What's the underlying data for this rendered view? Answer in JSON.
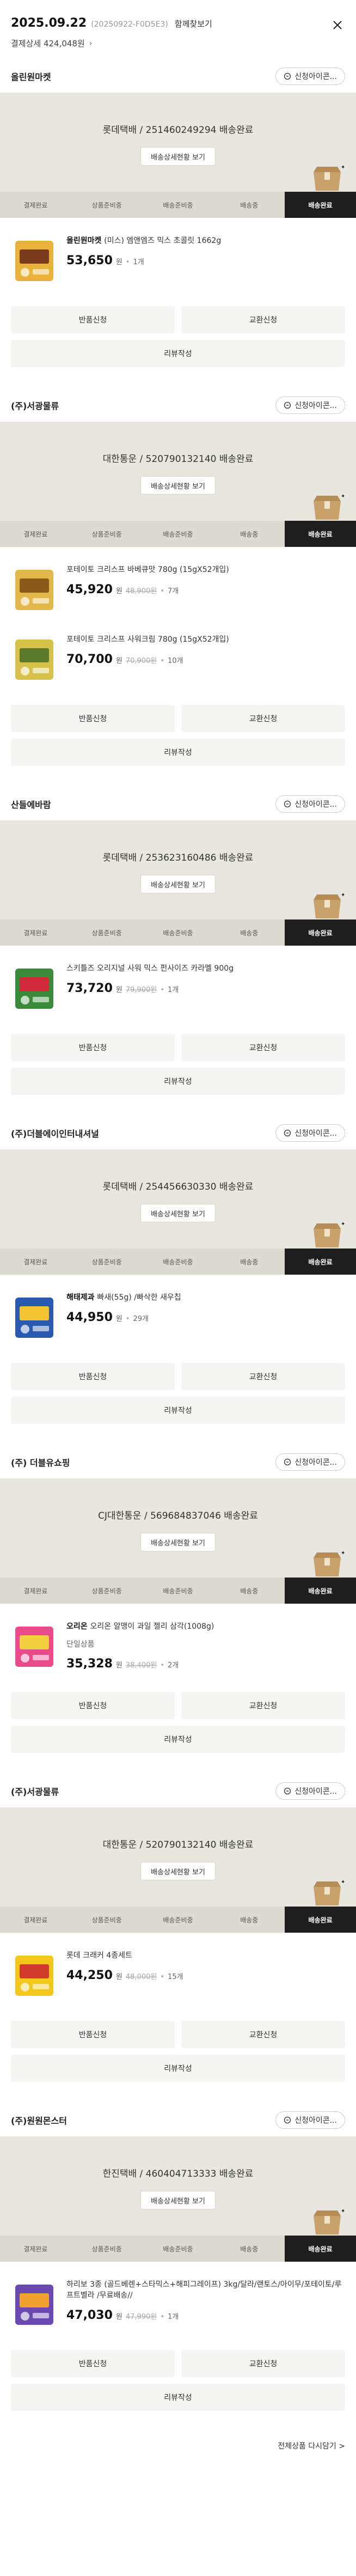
{
  "header": {
    "date": "2025.09.22",
    "order_no": "(20250922-F0D5E3)",
    "view_all": "함께찾보기",
    "payment": "결제상세 424,048원"
  },
  "tracking_button": "배송상세현황 보기",
  "inquiry_label": "신청아이콘...",
  "steps": [
    "결제완료",
    "상품준비중",
    "배송준비중",
    "배송중",
    "배송완료"
  ],
  "actions": {
    "return": "반품신청",
    "exchange": "교환신청",
    "review": "리뷰작성"
  },
  "shipments": [
    {
      "seller": "올린원마켓",
      "tracking": "롯데택배 / 251460249294 배송완료",
      "items": [
        {
          "brand": "올린원마켓",
          "name": "(미스) 엠앤엠즈 믹스 초콜릿 1662g",
          "option": "",
          "price": "53,650",
          "orig": "",
          "qty": "1개"
        }
      ]
    },
    {
      "seller": "(주)서광물류",
      "tracking": "대한통운 / 520790132140 배송완료",
      "items": [
        {
          "brand": "",
          "name": "포테이토 크리스프 바베큐맛 780g (15gX52개입)",
          "option": "",
          "price": "45,920",
          "orig": "48,900원",
          "qty": "7개"
        },
        {
          "brand": "",
          "name": "포테이토 크리스프 사워크림 780g (15gX52개입)",
          "option": "",
          "price": "70,700",
          "orig": "70,900원",
          "qty": "10개"
        }
      ]
    },
    {
      "seller": "산들에바람",
      "tracking": "롯데택배 / 253623160486 배송완료",
      "items": [
        {
          "brand": "",
          "name": "스키틀즈 오리지널 사워 믹스 펀사이즈 카라멜 900g",
          "option": "",
          "price": "73,720",
          "orig": "79,900원",
          "qty": "1개"
        }
      ]
    },
    {
      "seller": "(주)더블에이인터내셔널",
      "tracking": "롯데택배 / 254456630330 배송완료",
      "items": [
        {
          "brand": "해태제과",
          "name": "빠새(55g) /빠삭한 새우칩",
          "option": "",
          "price": "44,950",
          "orig": "",
          "qty": "29개"
        }
      ]
    },
    {
      "seller": "(주) 더블유쇼핑",
      "tracking": "CJ대한통운 / 569684837046 배송완료",
      "items": [
        {
          "brand": "오리온",
          "name": "오리온 알맹이 과일 젤리 삼각(1008g)",
          "option": "단일상품",
          "price": "35,328",
          "orig": "38,400원",
          "qty": "2개"
        }
      ]
    },
    {
      "seller": "(주)서광물류",
      "tracking": "대한통운 / 520790132140 배송완료",
      "items": [
        {
          "brand": "",
          "name": "롯데 크래커 4종세트",
          "option": "",
          "price": "44,250",
          "orig": "48,000원",
          "qty": "15개"
        }
      ]
    },
    {
      "seller": "(주)원원몬스터",
      "tracking": "한진택배 / 460404713333 배송완료",
      "items": [
        {
          "brand": "",
          "name": "하리보 3종 (골드베렌+스타믹스+해피그레이프) 3kg/달라/랜토스/아이무/포테이토/루프트벨라 /무료배송//",
          "option": "",
          "price": "47,030",
          "orig": "47,990원",
          "qty": "1개"
        }
      ]
    }
  ],
  "footer": "전체상품 다시담기 >",
  "colors": {
    "panel": "#e7e6df",
    "step": "#dcdbd2",
    "active": "#1e1e1e",
    "button": "#f5f5f3"
  }
}
